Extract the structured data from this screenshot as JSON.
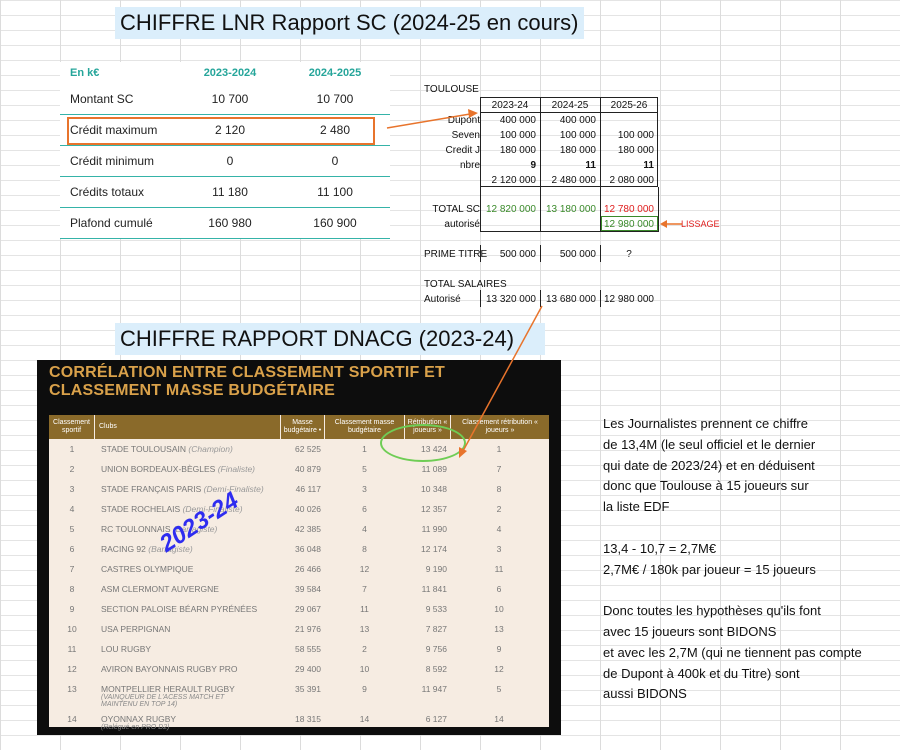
{
  "header_lnr": "CHIFFRE LNR Rapport SC (2024-25 en cours)",
  "header_dnacg": "CHIFFRE RAPPORT DNACG (2023-24)",
  "lnr_table": {
    "unit": "En k€",
    "columns": [
      "2023-2024",
      "2024-2025"
    ],
    "rows": [
      {
        "label": "Montant SC",
        "v1": "10 700",
        "v2": "10 700"
      },
      {
        "label": "Crédit maximum",
        "v1": "2 120",
        "v2": "2 480"
      },
      {
        "label": "Crédit minimum",
        "v1": "0",
        "v2": "0"
      },
      {
        "label": "Crédits totaux",
        "v1": "11 180",
        "v2": "11 100"
      },
      {
        "label": "Plafond cumulé",
        "v1": "160 980",
        "v2": "160 900"
      }
    ]
  },
  "toulouse": {
    "title": "TOULOUSE",
    "columns": [
      "2023-24",
      "2024-25",
      "2025-26"
    ],
    "rows": [
      {
        "label": "Dupont",
        "v": [
          "400 000",
          "400 000",
          ""
        ]
      },
      {
        "label": "Seven",
        "v": [
          "100 000",
          "100 000",
          "100 000"
        ]
      },
      {
        "label": "Credit J",
        "v": [
          "180 000",
          "180 000",
          "180 000"
        ]
      },
      {
        "label": "nbre",
        "v": [
          "9",
          "11",
          "11"
        ]
      },
      {
        "label": "",
        "v": [
          "2 120 000",
          "2 480 000",
          "2 080 000"
        ]
      }
    ],
    "total_sc_label": "TOTAL SC",
    "total_sc": [
      "12 820 000",
      "13 180 000",
      "12 780 000"
    ],
    "autorise_label": "autorisé",
    "autorise_value": "12 980 000",
    "lissage": "LISSAGE",
    "prime_label": "PRIME TITRE",
    "prime": [
      "500 000",
      "500 000",
      "?"
    ],
    "total_salaires_label": "TOTAL SALAIRES",
    "autorise2_label": "Autorisé",
    "autorise2": [
      "13 320 000",
      "13 680 000",
      "12 980 000"
    ]
  },
  "dnacg": {
    "title": "CORRÉLATION ENTRE CLASSEMENT SPORTIF ET CLASSEMENT MASSE BUDGÉTAIRE",
    "headers": [
      "Classement sportif",
      "Clubs",
      "Masse budgétaire •",
      "Classement masse budgétaire",
      "Rétribution « joueurs »",
      "Classement rétribution « joueurs »"
    ],
    "rows": [
      {
        "rank": "1",
        "club": "STADE TOULOUSAIN",
        "note": "(Champion)",
        "masse": "62 525",
        "cm": "1",
        "retrib": "13 424",
        "cr": "1"
      },
      {
        "rank": "2",
        "club": "UNION BORDEAUX-BÈGLES",
        "note": "(Finaliste)",
        "masse": "40 879",
        "cm": "5",
        "retrib": "11 089",
        "cr": "7"
      },
      {
        "rank": "3",
        "club": "STADE FRANÇAIS PARIS",
        "note": "(Demi-Finaliste)",
        "masse": "46 117",
        "cm": "3",
        "retrib": "10 348",
        "cr": "8"
      },
      {
        "rank": "4",
        "club": "STADE ROCHELAIS",
        "note": "(Demi-Finaliste)",
        "masse": "40 026",
        "cm": "6",
        "retrib": "12 357",
        "cr": "2"
      },
      {
        "rank": "5",
        "club": "RC TOULONNAIS",
        "note": "(Barragiste)",
        "masse": "42 385",
        "cm": "4",
        "retrib": "11 990",
        "cr": "4"
      },
      {
        "rank": "6",
        "club": "RACING 92",
        "note": "(Barragiste)",
        "masse": "36 048",
        "cm": "8",
        "retrib": "12 174",
        "cr": "3"
      },
      {
        "rank": "7",
        "club": "CASTRES OLYMPIQUE",
        "note": "",
        "masse": "26 466",
        "cm": "12",
        "retrib": "9 190",
        "cr": "11"
      },
      {
        "rank": "8",
        "club": "ASM CLERMONT AUVERGNE",
        "note": "",
        "masse": "39 584",
        "cm": "7",
        "retrib": "11 841",
        "cr": "6"
      },
      {
        "rank": "9",
        "club": "SECTION PALOISE BÉARN PYRÉNÉES",
        "note": "",
        "masse": "29 067",
        "cm": "11",
        "retrib": "9 533",
        "cr": "10"
      },
      {
        "rank": "10",
        "club": "USA PERPIGNAN",
        "note": "",
        "masse": "21 976",
        "cm": "13",
        "retrib": "7 827",
        "cr": "13"
      },
      {
        "rank": "11",
        "club": "LOU RUGBY",
        "note": "",
        "masse": "58 555",
        "cm": "2",
        "retrib": "9 756",
        "cr": "9"
      },
      {
        "rank": "12",
        "club": "AVIRON BAYONNAIS RUGBY PRO",
        "note": "",
        "masse": "29 400",
        "cm": "10",
        "retrib": "8 592",
        "cr": "12"
      },
      {
        "rank": "13",
        "club": "MONTPELLIER HERAULT RUGBY",
        "note": "",
        "sub": "(VAINQUEUR DE L'ACESS MATCH ET MAINTENU EN TOP 14)",
        "masse": "35 391",
        "cm": "9",
        "retrib": "11 947",
        "cr": "5"
      },
      {
        "rank": "14",
        "club": "OYONNAX RUGBY",
        "note": "",
        "sub": "(Relégué en PRO D2)",
        "masse": "18 315",
        "cm": "14",
        "retrib": "6 127",
        "cr": "14"
      }
    ],
    "watermark": "2023-24"
  },
  "notes": [
    "Les Journalistes prennent ce chiffre",
    "de 13,4M (le seul officiel et le dernier",
    "qui date de 2023/24) et en déduisent",
    "donc que Toulouse à 15 joueurs sur",
    "la liste EDF",
    "",
    "13,4 - 10,7 = 2,7M€",
    "2,7M€ / 180k par joueur = 15 joueurs",
    "",
    "Donc toutes les hypothèses qu'ils font",
    "avec 15 joueurs sont BIDONS",
    "et avec les 2,7M (qui ne tiennent pas compte",
    "de Dupont à 400k et du Titre) sont",
    "aussi BIDONS"
  ],
  "colors": {
    "accent_orange": "#e8742c",
    "teal": "#35b3a8",
    "header_bg": "#dbeefb",
    "green": "#3a8a2a",
    "red": "#e02020"
  }
}
